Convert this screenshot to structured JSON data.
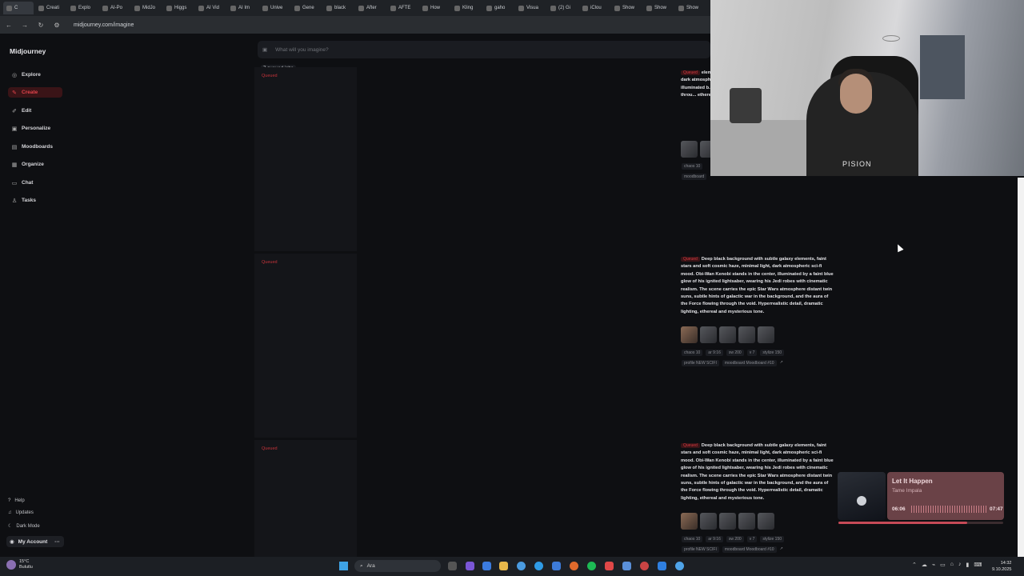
{
  "browser": {
    "tabs": [
      "C",
      "Creati",
      "Explo",
      "AI-Po",
      "MidJo",
      "Higgs",
      "AI Vid",
      "AI Im",
      "Unive",
      "Gene",
      "black",
      "After",
      "AFTE",
      "How",
      "Kling",
      "gaho",
      "Visua",
      "(2) Gi",
      "iClou",
      "Show",
      "Show",
      "Show"
    ],
    "url": "midjourney.com/imagine"
  },
  "sidebar": {
    "brand": "Midjourney",
    "items": [
      {
        "label": "Explore",
        "icon": "compass-icon"
      },
      {
        "label": "Create",
        "icon": "brush-icon"
      },
      {
        "label": "Edit",
        "icon": "edit-icon"
      },
      {
        "label": "Personalize",
        "icon": "personalize-icon"
      },
      {
        "label": "Moodboards",
        "icon": "moodboard-icon"
      },
      {
        "label": "Organize",
        "icon": "grid-icon"
      },
      {
        "label": "Chat",
        "icon": "chat-icon"
      },
      {
        "label": "Tasks",
        "icon": "thumbs-up-icon"
      }
    ],
    "bottom": {
      "help": "Help",
      "updates": "Updates",
      "dark_mode": "Dark Mode",
      "account": "My Account"
    }
  },
  "search": {
    "placeholder": "What will you imagine?"
  },
  "queue": {
    "count_label": "7 queued jobs",
    "queued_label": "Queued"
  },
  "jobs": [
    {
      "tag": "Queued",
      "prompt": "elements, faint stars and soft cosmic haze, minimal light, dark atmospheric sci-fi mood. Obi-Wan Kenobi stands in the center, illuminated b... his Jedi robe... epic Star War... galactic war i... flowing throu... ethereal and...",
      "params": [
        "chaos 10"
      ],
      "params2": [
        "moodboard"
      ]
    },
    {
      "tag": "Queued",
      "prompt": "Deep black background with subtle galaxy elements, faint stars and soft cosmic haze, minimal light, dark atmospheric sci-fi mood. Obi-Wan Kenobi stands in the center, illuminated by a faint blue glow of his ignited lightsaber, wearing his Jedi robes with cinematic realism. The scene carries the epic Star Wars atmosphere distant twin suns, subtle hints of galactic war in the background, and the aura of the Force flowing through the void. Hyperrealistic detail, dramatic lighting, ethereal and mysterious tone.",
      "params": [
        "chaos 10",
        "ar 9:16",
        "sw 200",
        "v 7",
        "stylize 150"
      ],
      "params2": [
        "profile NEW SCIFI",
        "moodboard Moodboard #10"
      ]
    },
    {
      "tag": "Queued",
      "prompt": "Deep black background with subtle galaxy elements, faint stars and soft cosmic haze, minimal light, dark atmospheric sci-fi mood. Obi-Wan Kenobi stands in the center, illuminated by a faint blue glow of his ignited lightsaber, wearing his Jedi robes with cinematic realism. The scene carries the epic Star Wars atmosphere distant twin suns, subtle hints of galactic war in the background, and the aura of the Force flowing through the void. Hyperrealistic detail, dramatic lighting, ethereal and mysterious tone.",
      "params": [
        "chaos 10",
        "ar 9:16",
        "sw 200",
        "v 7",
        "stylize 150"
      ],
      "params2": [
        "profile NEW SCIFI",
        "moodboard Moodboard #10"
      ]
    }
  ],
  "music": {
    "title": "Let It Happen",
    "artist": "Tame Impala",
    "elapsed": "06:06",
    "total": "07:47",
    "progress": 0.78
  },
  "taskbar": {
    "weather_temp": "15°C",
    "weather_desc": "Bulutlu",
    "search_label": "Ara",
    "time": "14:32",
    "date": "9.10.2025"
  },
  "webcam": {
    "shirt_text": "PISION"
  }
}
